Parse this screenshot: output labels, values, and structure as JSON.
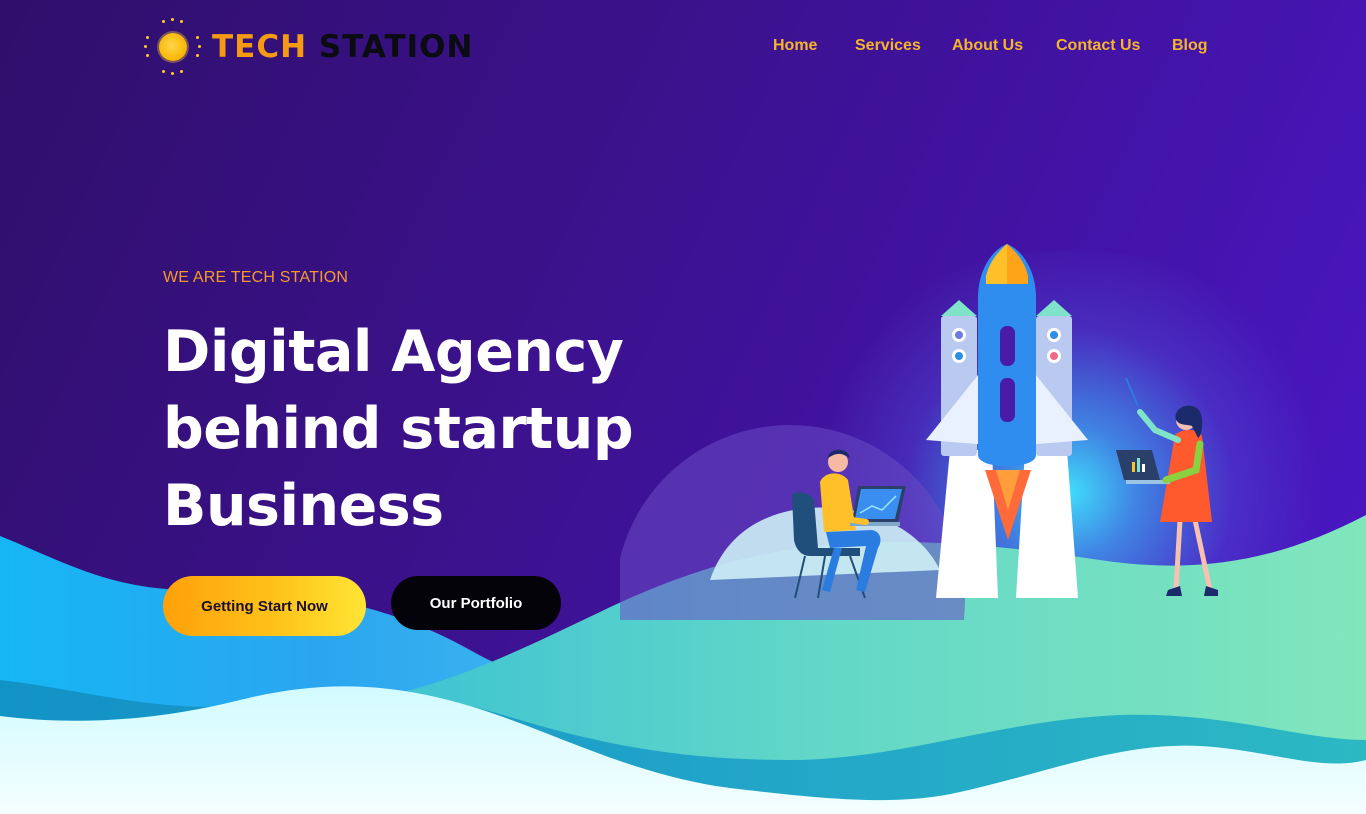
{
  "brand": {
    "name_part1": "TECH",
    "name_part2": "STATION"
  },
  "nav": {
    "items": [
      "Home",
      "Services",
      "About Us",
      "Contact Us",
      "Blog"
    ]
  },
  "hero": {
    "eyebrow": "WE ARE TECH STATION",
    "headline_lines": [
      "Digital Agency",
      "behind startup",
      "Business"
    ],
    "primary_button": "Getting Start Now",
    "secondary_button": "Our Portfolio"
  },
  "icons": {
    "logo": "sun-logo-icon",
    "illustration": "rocket-launch-illustration"
  },
  "colors": {
    "brand_orange": "#f59a12",
    "nav_link": "#f4b52a",
    "background_purple": "#3a1188",
    "wave_teal": "#7de3c0",
    "button_yellow": "#ffc21a"
  }
}
